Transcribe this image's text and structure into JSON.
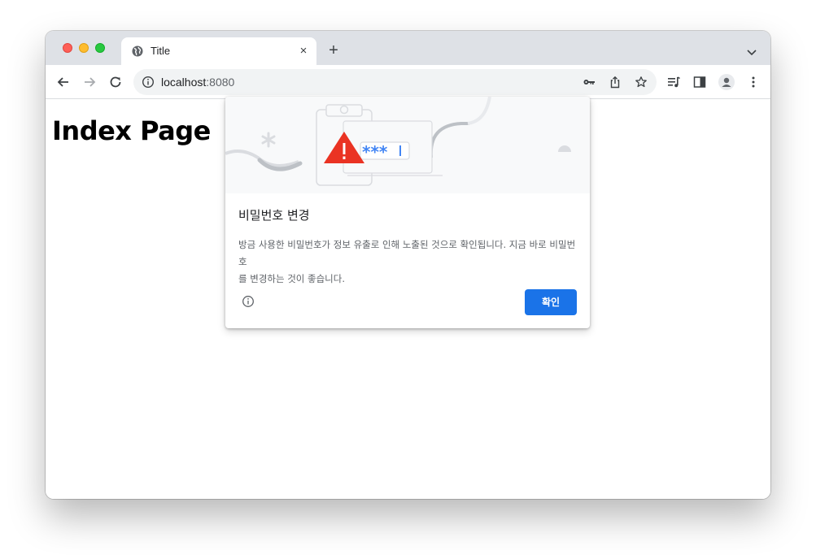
{
  "browser": {
    "tab": {
      "title": "Title",
      "favicon": "globe-icon",
      "close": "×"
    },
    "new_tab": "+",
    "omnibox": {
      "host": "localhost",
      "port": ":8080"
    }
  },
  "page": {
    "heading": "Index Page"
  },
  "dialog": {
    "title": "비밀번호 변경",
    "body_line1": "방금 사용한 비밀번호가 정보 유출로 인해 노출된 것으로 확인됩니다. 지금 바로 비밀번호",
    "body_line2": "를 변경하는 것이 좋습니다.",
    "ok_label": "확인",
    "illustration_text": "***",
    "colors": {
      "accent": "#1a73e8",
      "warning": "#d93025"
    }
  }
}
